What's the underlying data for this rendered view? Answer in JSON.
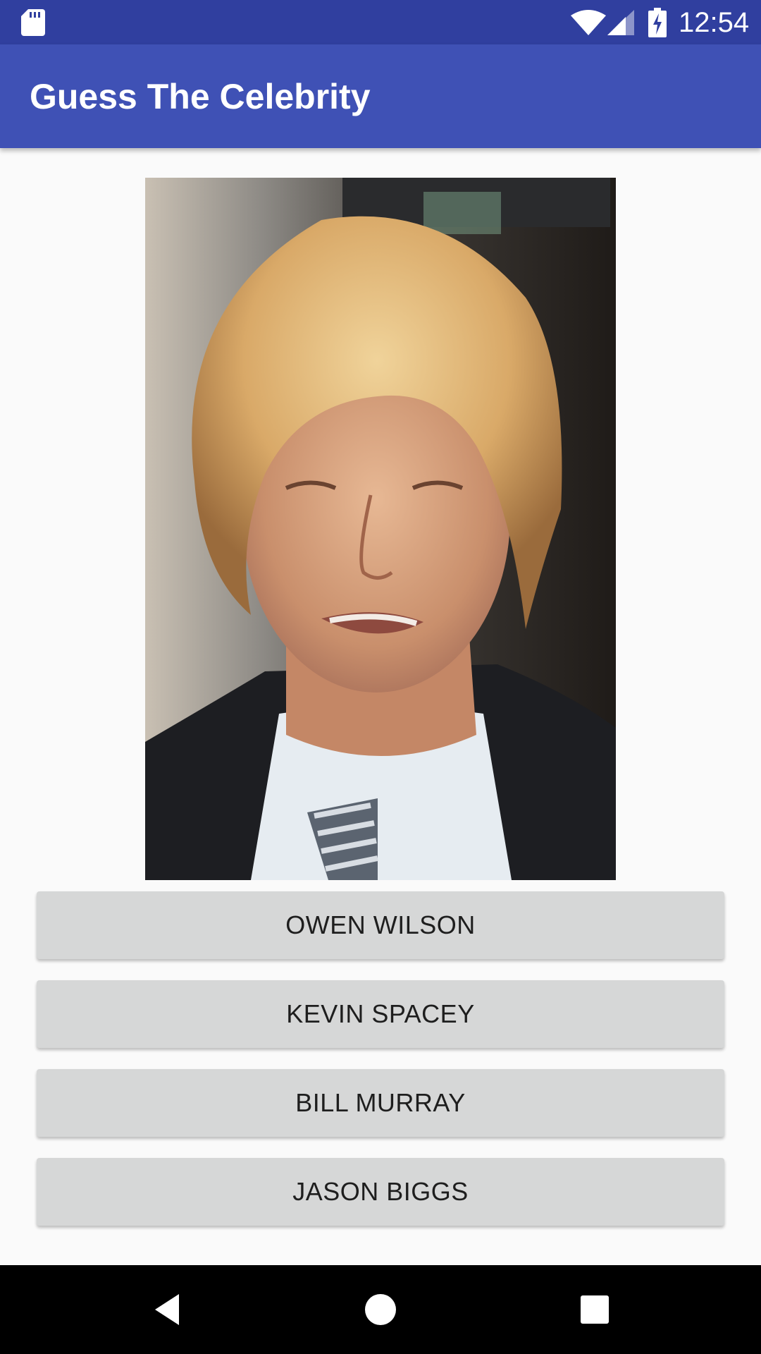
{
  "status_bar": {
    "time": "12:54",
    "icons": [
      "sd-card-icon",
      "wifi-icon",
      "signal-icon",
      "battery-charging-icon"
    ]
  },
  "app_bar": {
    "title": "Guess The Celebrity"
  },
  "photo": {
    "description_icon": "celebrity-photo"
  },
  "answers": [
    {
      "label": "OWEN WILSON"
    },
    {
      "label": "KEVIN SPACEY"
    },
    {
      "label": "BILL MURRAY"
    },
    {
      "label": "JASON BIGGS"
    }
  ],
  "nav_bar": {
    "icons": [
      "back-icon",
      "home-icon",
      "recents-icon"
    ]
  },
  "colors": {
    "status_bar": "#303f9f",
    "app_bar": "#3f51b5",
    "button": "#d6d7d7",
    "background": "#fafafa"
  }
}
